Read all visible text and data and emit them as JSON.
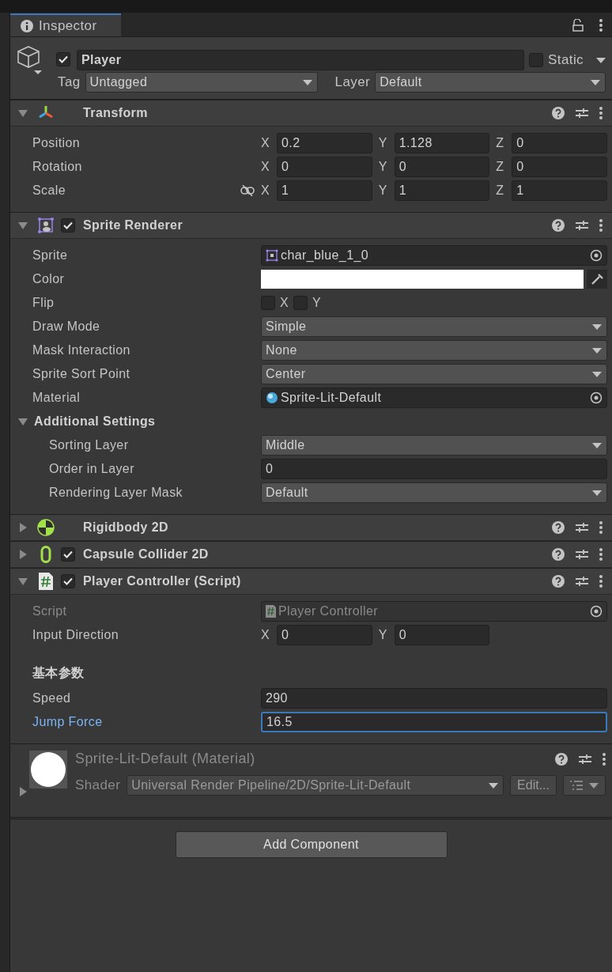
{
  "tab": {
    "title": "Inspector",
    "selected": true
  },
  "game_object": {
    "active": true,
    "name": "Player",
    "static": false,
    "static_label": "Static",
    "tag_label": "Tag",
    "tag": "Untagged",
    "layer_label": "Layer",
    "layer": "Default"
  },
  "components": [
    {
      "kind": "transform",
      "title": "Transform",
      "expanded": true,
      "rows": [
        {
          "kind": "vector",
          "label": "Position",
          "values": [
            {
              "axis": "X",
              "value": "0.2"
            },
            {
              "axis": "Y",
              "value": "1.128"
            },
            {
              "axis": "Z",
              "value": "0"
            }
          ]
        },
        {
          "kind": "vector",
          "label": "Rotation",
          "values": [
            {
              "axis": "X",
              "value": "0"
            },
            {
              "axis": "Y",
              "value": "0"
            },
            {
              "axis": "Z",
              "value": "0"
            }
          ]
        },
        {
          "kind": "vector",
          "label": "Scale",
          "constrain_proportions": false,
          "values": [
            {
              "axis": "X",
              "value": "1"
            },
            {
              "axis": "Y",
              "value": "1"
            },
            {
              "axis": "Z",
              "value": "1"
            }
          ]
        }
      ]
    },
    {
      "kind": "sprite_renderer",
      "title": "Sprite Renderer",
      "enabled": true,
      "expanded": true,
      "rows": [
        {
          "kind": "sprite_ref",
          "label": "Sprite",
          "value": "char_blue_1_0"
        },
        {
          "kind": "color",
          "label": "Color",
          "color": "#ffffff"
        },
        {
          "kind": "flip",
          "label": "Flip",
          "options": [
            {
              "label": "X",
              "checked": false
            },
            {
              "label": "Y",
              "checked": false
            }
          ]
        },
        {
          "kind": "dropdown",
          "label": "Draw Mode",
          "value": "Simple"
        },
        {
          "kind": "dropdown",
          "label": "Mask Interaction",
          "value": "None"
        },
        {
          "kind": "dropdown",
          "label": "Sprite Sort Point",
          "value": "Center"
        },
        {
          "kind": "material_ref",
          "label": "Material",
          "value": "Sprite-Lit-Default"
        },
        {
          "kind": "foldout",
          "label": "Additional Settings",
          "expanded": true,
          "children": [
            {
              "kind": "dropdown",
              "label": "Sorting Layer",
              "value": "Middle"
            },
            {
              "kind": "text",
              "label": "Order in Layer",
              "value": "0"
            },
            {
              "kind": "dropdown",
              "label": "Rendering Layer Mask",
              "value": "Default"
            }
          ]
        }
      ]
    },
    {
      "kind": "rigidbody",
      "title": "Rigidbody 2D",
      "expanded": false
    },
    {
      "kind": "collider",
      "title": "Capsule Collider 2D",
      "enabled": true,
      "expanded": false
    },
    {
      "kind": "script",
      "title": "Player Controller (Script)",
      "enabled": true,
      "expanded": true,
      "rows": [
        {
          "kind": "script_ref",
          "label": "Script",
          "value": "Player Controller",
          "disabled": true
        },
        {
          "kind": "vector",
          "label": "Input Direction",
          "values": [
            {
              "axis": "X",
              "value": "0"
            },
            {
              "axis": "Y",
              "value": "0"
            }
          ]
        },
        {
          "kind": "header",
          "label": "基本参数"
        },
        {
          "kind": "text",
          "label": "Speed",
          "value": "290"
        },
        {
          "kind": "text",
          "label": "Jump Force",
          "value": "16.5",
          "focused": true
        }
      ]
    }
  ],
  "material": {
    "title": "Sprite-Lit-Default (Material)",
    "expanded": false,
    "shader_label": "Shader",
    "shader": "Universal Render Pipeline/2D/Sprite-Lit-Default",
    "edit_button": "Edit..."
  },
  "add_component": "Add Component"
}
